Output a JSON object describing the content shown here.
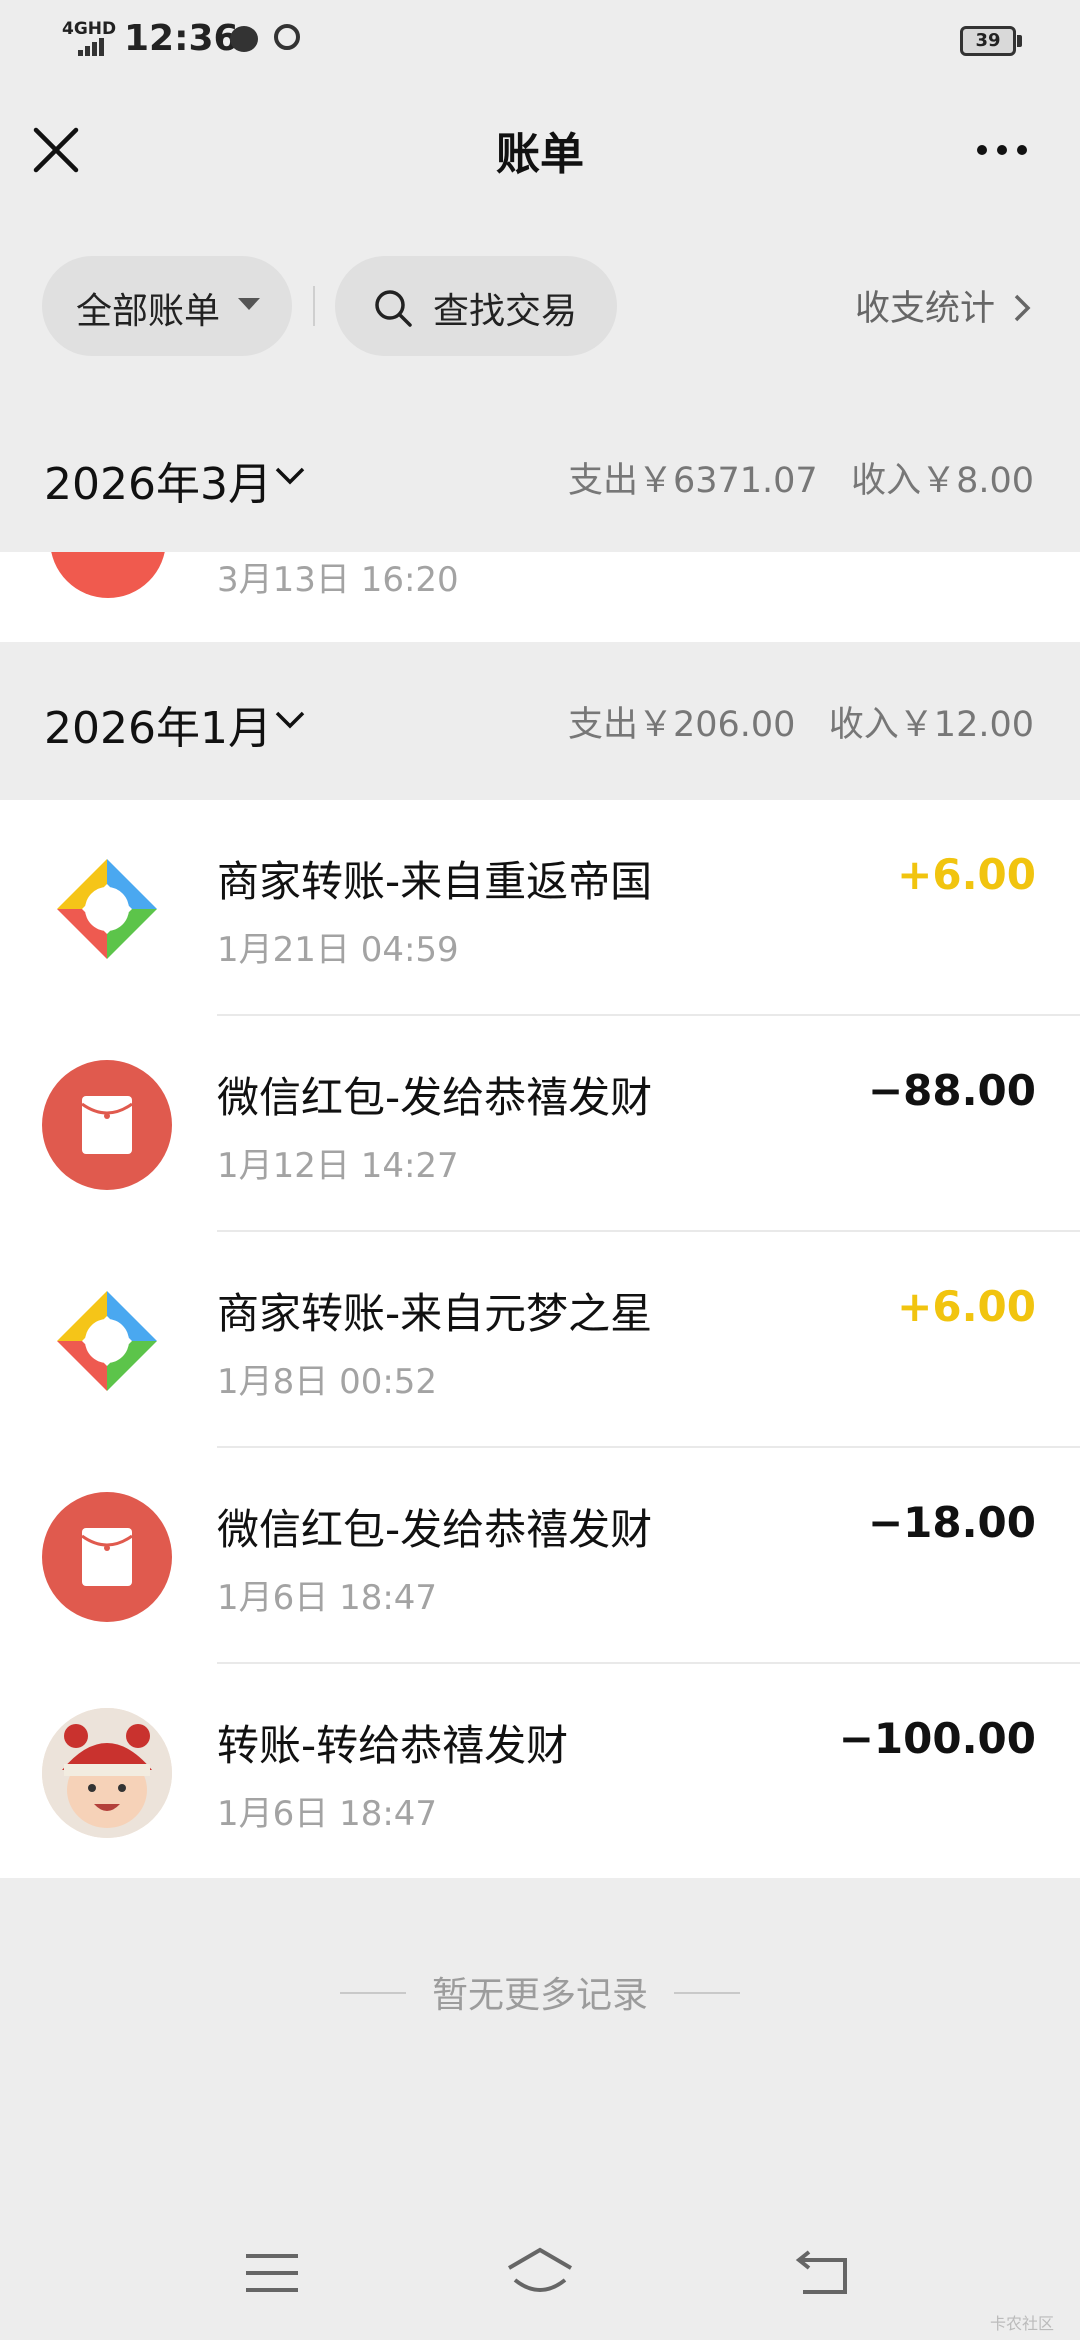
{
  "status_bar": {
    "network": "4GHD",
    "time": "12:36",
    "battery": "39"
  },
  "header": {
    "title": "账单"
  },
  "filters": {
    "all_bills": "全部账单",
    "search": "查找交易",
    "stats": "收支统计"
  },
  "months": [
    {
      "title": "2026年3月",
      "summary": "支出￥6371.07   收入￥8.00",
      "partial_item_time": "3月13日 16:20"
    },
    {
      "title": "2026年1月",
      "summary": "支出￥206.00   收入￥12.00",
      "items": [
        {
          "title": "商家转账-来自重返帝国",
          "time": "1月21日 04:59",
          "amount": "+6.00",
          "icon": "merchant-transfer-icon"
        },
        {
          "title": "微信红包-发给恭禧发财",
          "time": "1月12日 14:27",
          "amount": "−88.00",
          "icon": "red-packet-icon"
        },
        {
          "title": "商家转账-来自元梦之星",
          "time": "1月8日 00:52",
          "amount": "+6.00",
          "icon": "merchant-transfer-icon"
        },
        {
          "title": "微信红包-发给恭禧发财",
          "time": "1月6日 18:47",
          "amount": "−18.00",
          "icon": "red-packet-icon"
        },
        {
          "title": "转账-转给恭禧发财",
          "time": "1月6日 18:47",
          "amount": "−100.00",
          "icon": "baby-avatar"
        }
      ]
    }
  ],
  "footer": {
    "no_more": "暂无更多记录"
  },
  "watermark": "卡农社区",
  "colors": {
    "income": "#f1c40f",
    "red_packet": "#e05a4e",
    "background": "#ededed"
  }
}
